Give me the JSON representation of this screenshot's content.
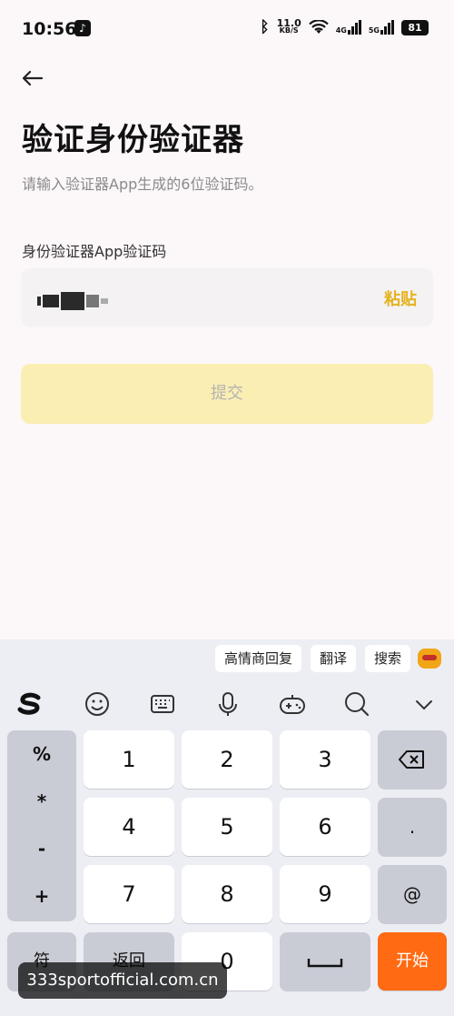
{
  "status_bar": {
    "time": "10:56",
    "speed_value": "11.0",
    "speed_unit": "KB/S",
    "network_1": "4G",
    "network_2": "5G",
    "battery": "81",
    "app_icon": "tiktok-icon"
  },
  "header": {
    "back_icon": "arrow-left-icon",
    "title": "验证身份验证器",
    "subtitle": "请输入验证器App生成的6位验证码。"
  },
  "form": {
    "field_label": "身份验证器App验证码",
    "code_value": "••••••",
    "paste_label": "粘贴",
    "submit_label": "提交"
  },
  "keyboard": {
    "suggestions": [
      "高情商回复",
      "翻译",
      "搜索"
    ],
    "toolbar_icons": [
      "sogou-logo-icon",
      "emoji-icon",
      "keyboard-icon",
      "microphone-icon",
      "gamepad-icon",
      "search-icon",
      "chevron-down-icon"
    ],
    "side_symbols": [
      "%",
      "*",
      "-",
      "+"
    ],
    "digits": [
      "1",
      "2",
      "3",
      "4",
      "5",
      "6",
      "7",
      "8",
      "9",
      "0"
    ],
    "dot": ".",
    "at": "@",
    "symbol_key": "符",
    "back_key": "返回",
    "start_key": "开始"
  },
  "watermark": "333sportofficial.com.cn",
  "colors": {
    "accent": "#e4b320",
    "submit_bg": "#fbeeb3",
    "start_bg": "#ff6a12"
  }
}
